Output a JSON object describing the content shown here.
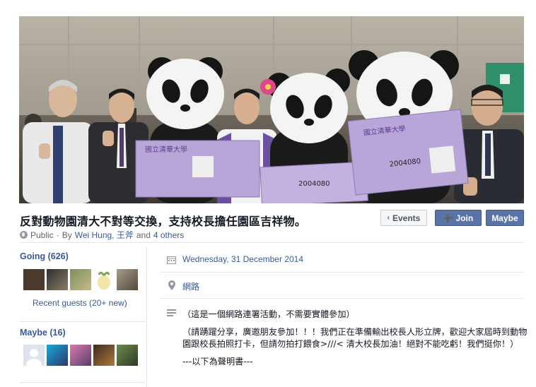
{
  "event": {
    "title": "反對動物園清大不對等交換，支持校長擔任園區吉祥物。",
    "privacy": "Public",
    "by_prefix": "By",
    "hosts": "Wei Hung, 王斧",
    "others": "4 others",
    "and": "and"
  },
  "actions": {
    "events_label": "Events",
    "join_label": "Join",
    "maybe_label": "Maybe"
  },
  "sidebar": {
    "going_label": "Going (626)",
    "recent_guests": "Recent guests (20+ new)",
    "maybe_label": "Maybe (16)"
  },
  "details": {
    "date": "Wednesday, 31 December 2014",
    "location": "網路",
    "description": [
      "（這是一個網路連署活動，不需要實體參加）",
      "（請踴躍分享，廣邀朋友參加！！！我們正在準備輸出校長人形立牌，歡迎大家屆時到動物園跟校長拍照打卡，但請勿拍打餵食>///< 清大校長加油！絕對不能吃虧！我們挺你！）",
      "---以下為聲明書---"
    ]
  },
  "cover_signs": {
    "brand": "國立清華大學",
    "number": "2004080"
  },
  "colors": {
    "link": "#3b5998",
    "button_primary": "#5b74a8",
    "sign_purple": "#b9a6d9"
  }
}
